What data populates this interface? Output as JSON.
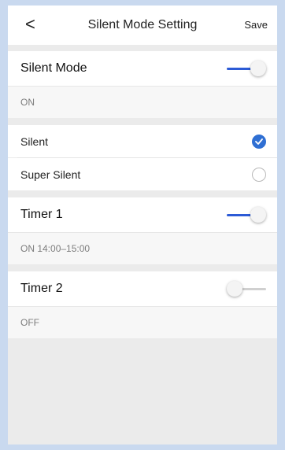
{
  "header": {
    "back_symbol": "<",
    "title": "Silent Mode Setting",
    "save_label": "Save"
  },
  "silent_mode": {
    "label": "Silent Mode",
    "enabled": true,
    "status": "ON"
  },
  "options": [
    {
      "label": "Silent",
      "selected": true
    },
    {
      "label": "Super Silent",
      "selected": false
    }
  ],
  "timer1": {
    "label": "Timer 1",
    "enabled": true,
    "status": "ON 14:00–15:00"
  },
  "timer2": {
    "label": "Timer 2",
    "enabled": false,
    "status": "OFF"
  },
  "colors": {
    "accent": "#2c5bd6",
    "check": "#2f6fd3",
    "background": "#ebebeb"
  },
  "icons": {
    "back": "chevron-left-icon",
    "check": "checkmark-icon"
  }
}
